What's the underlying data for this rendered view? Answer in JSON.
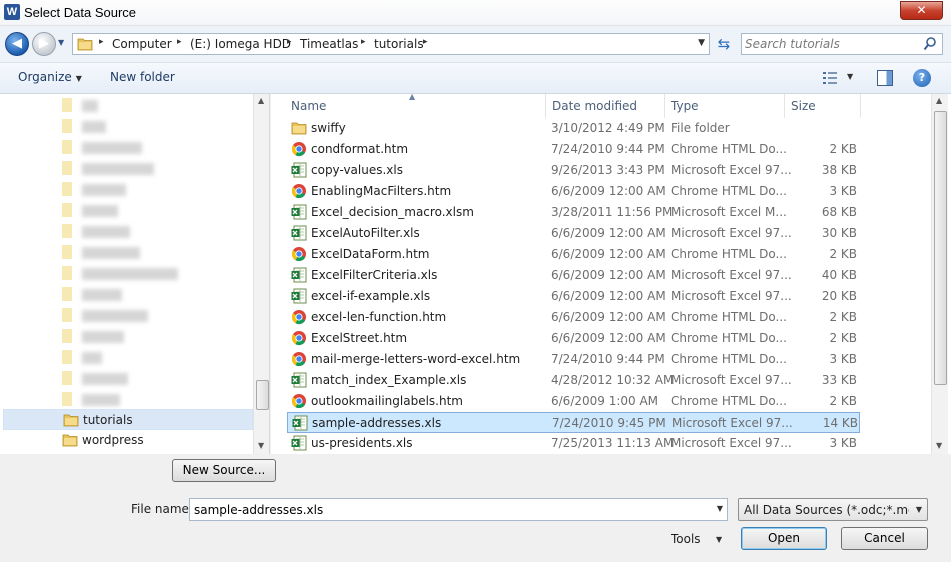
{
  "window": {
    "title": "Select Data Source",
    "app_icon_letter": "W",
    "close_glyph": "✕"
  },
  "address": {
    "crumbs": [
      "Computer",
      "(E:) Iomega HDD",
      "Timeatlas",
      "tutorials"
    ],
    "separator": "▸",
    "search_placeholder": "Search tutorials"
  },
  "toolbar": {
    "organize_label": "Organize",
    "new_folder_label": "New folder"
  },
  "nav": {
    "items": [
      {
        "label": "tutorials",
        "selected": true
      },
      {
        "label": "wordpress",
        "selected": false
      }
    ]
  },
  "columns": {
    "name": "Name",
    "date": "Date modified",
    "type": "Type",
    "size": "Size"
  },
  "files": [
    {
      "name": "swiffy",
      "date": "3/10/2012 4:49 PM",
      "type": "File folder",
      "size": "",
      "icon": "folder-icon"
    },
    {
      "name": "condformat.htm",
      "date": "7/24/2010 9:44 PM",
      "type": "Chrome HTML Do...",
      "size": "2 KB",
      "icon": "chrome-html-icon"
    },
    {
      "name": "copy-values.xls",
      "date": "9/26/2013 3:43 PM",
      "type": "Microsoft Excel 97...",
      "size": "38 KB",
      "icon": "excel-icon"
    },
    {
      "name": "EnablingMacFilters.htm",
      "date": "6/6/2009 12:00 AM",
      "type": "Chrome HTML Do...",
      "size": "3 KB",
      "icon": "chrome-html-icon"
    },
    {
      "name": "Excel_decision_macro.xlsm",
      "date": "3/28/2011 11:56 PM",
      "type": "Microsoft Excel M...",
      "size": "68 KB",
      "icon": "excel-icon"
    },
    {
      "name": "ExcelAutoFilter.xls",
      "date": "6/6/2009 12:00 AM",
      "type": "Microsoft Excel 97...",
      "size": "30 KB",
      "icon": "excel-icon"
    },
    {
      "name": "ExcelDataForm.htm",
      "date": "6/6/2009 12:00 AM",
      "type": "Chrome HTML Do...",
      "size": "2 KB",
      "icon": "chrome-html-icon"
    },
    {
      "name": "ExcelFilterCriteria.xls",
      "date": "6/6/2009 12:00 AM",
      "type": "Microsoft Excel 97...",
      "size": "40 KB",
      "icon": "excel-icon"
    },
    {
      "name": "excel-if-example.xls",
      "date": "6/6/2009 12:00 AM",
      "type": "Microsoft Excel 97...",
      "size": "20 KB",
      "icon": "excel-icon"
    },
    {
      "name": "excel-len-function.htm",
      "date": "6/6/2009 12:00 AM",
      "type": "Chrome HTML Do...",
      "size": "2 KB",
      "icon": "chrome-html-icon"
    },
    {
      "name": "ExcelStreet.htm",
      "date": "6/6/2009 12:00 AM",
      "type": "Chrome HTML Do...",
      "size": "2 KB",
      "icon": "chrome-html-icon"
    },
    {
      "name": "mail-merge-letters-word-excel.htm",
      "date": "7/24/2010 9:44 PM",
      "type": "Chrome HTML Do...",
      "size": "3 KB",
      "icon": "chrome-html-icon"
    },
    {
      "name": "match_index_Example.xls",
      "date": "4/28/2012 10:32 AM",
      "type": "Microsoft Excel 97...",
      "size": "33 KB",
      "icon": "excel-icon"
    },
    {
      "name": "outlookmailinglabels.htm",
      "date": "6/6/2009 1:00 AM",
      "type": "Chrome HTML Do...",
      "size": "2 KB",
      "icon": "chrome-html-icon"
    },
    {
      "name": "sample-addresses.xls",
      "date": "7/24/2010 9:45 PM",
      "type": "Microsoft Excel 97...",
      "size": "14 KB",
      "icon": "excel-icon",
      "selected": true
    },
    {
      "name": "us-presidents.xls",
      "date": "7/25/2013 11:13 AM",
      "type": "Microsoft Excel 97...",
      "size": "3 KB",
      "icon": "excel-icon"
    }
  ],
  "bottom": {
    "new_source_label": "New Source...",
    "file_name_label": "File name:",
    "file_name_value": "sample-addresses.xls",
    "filter_value": "All Data Sources (*.odc;*.mdb;*",
    "tools_label": "Tools",
    "open_label": "Open",
    "cancel_label": "Cancel"
  },
  "colors": {
    "selection": "#cce8ff",
    "selection_border": "#84acdd",
    "nav_selection": "#d9e7f7",
    "close_red": "#c7432f",
    "toolbar_text": "#1e3a64"
  }
}
